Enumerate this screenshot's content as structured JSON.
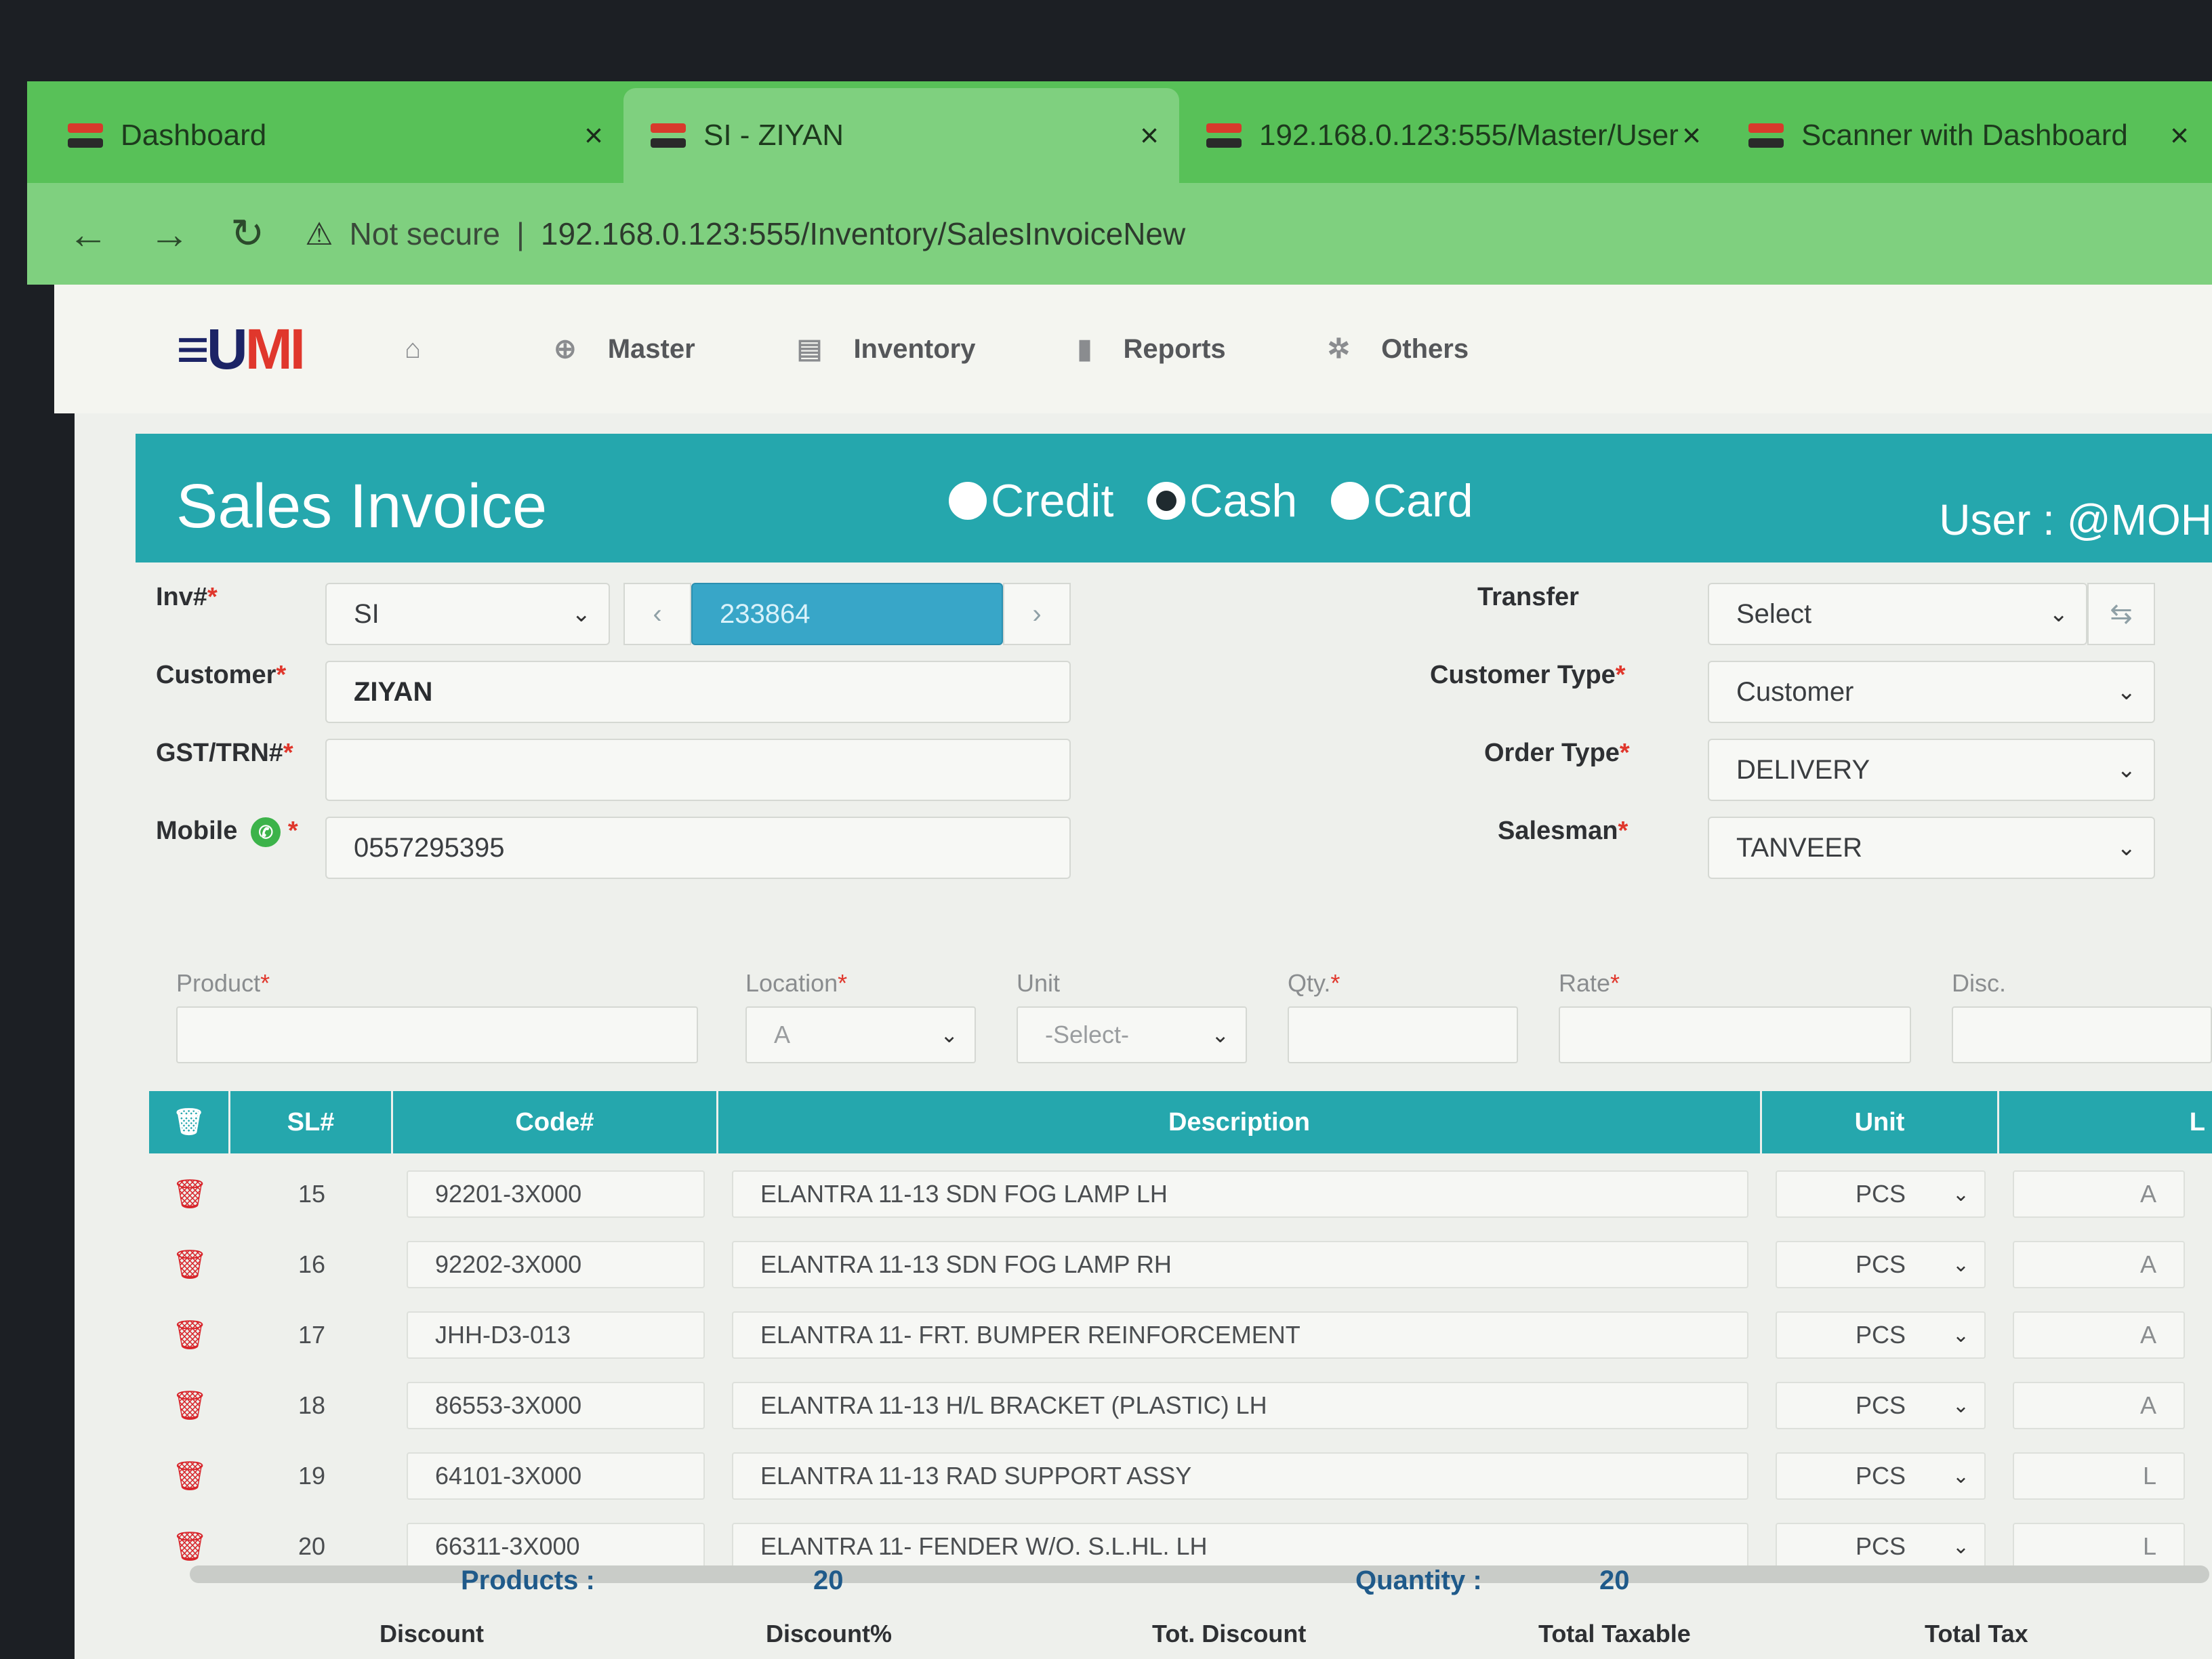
{
  "browser": {
    "tabs": [
      {
        "label": "Dashboard",
        "close": "×"
      },
      {
        "label": "SI - ZIYAN",
        "close": "×"
      },
      {
        "label": "192.168.0.123:555/Master/User",
        "close": "×"
      },
      {
        "label": "Scanner with Dashboard",
        "close": "×"
      }
    ],
    "security_label": "Not secure",
    "url": "192.168.0.123:555/Inventory/SalesInvoiceNew"
  },
  "app": {
    "logo_main": "≡U",
    "logo_accent": "MI",
    "menu": [
      "Master",
      "Inventory",
      "Reports",
      "Others"
    ]
  },
  "title": "Sales Invoice",
  "payment": {
    "options": [
      "Credit",
      "Cash",
      "Card"
    ],
    "selected": "Cash"
  },
  "user_label": "User : @MOH",
  "form": {
    "inv_label": "Inv#",
    "inv_prefix": "SI",
    "inv_number": "233864",
    "customer_label": "Customer",
    "customer": "ZIYAN",
    "gst_label": "GST/TRN#",
    "gst": "",
    "mobile_label": "Mobile",
    "mobile": "0557295395",
    "transfer_label": "Transfer",
    "transfer": "Select",
    "customer_type_label": "Customer Type",
    "customer_type": "Customer",
    "order_type_label": "Order Type",
    "order_type": "DELIVERY",
    "salesman_label": "Salesman",
    "salesman": "TANVEER",
    "req": "*"
  },
  "entry": {
    "product_label": "Product",
    "location_label": "Location",
    "location": "A",
    "unit_label": "Unit",
    "unit_placeholder": "-Select-",
    "qty_label": "Qty.",
    "rate_label": "Rate",
    "disc_label": "Disc."
  },
  "grid": {
    "headers": [
      "SL#",
      "Code#",
      "Description",
      "Unit",
      "L"
    ],
    "rows": [
      {
        "sl": "15",
        "code": "92201-3X000",
        "desc": "ELANTRA 11-13 SDN FOG LAMP LH",
        "unit": "PCS",
        "loc": "A"
      },
      {
        "sl": "16",
        "code": "92202-3X000",
        "desc": "ELANTRA 11-13 SDN FOG LAMP RH",
        "unit": "PCS",
        "loc": "A"
      },
      {
        "sl": "17",
        "code": "JHH-D3-013",
        "desc": "ELANTRA 11- FRT. BUMPER REINFORCEMENT",
        "unit": "PCS",
        "loc": "A"
      },
      {
        "sl": "18",
        "code": "86553-3X000",
        "desc": "ELANTRA 11-13 H/L BRACKET (PLASTIC) LH",
        "unit": "PCS",
        "loc": "A"
      },
      {
        "sl": "19",
        "code": "64101-3X000",
        "desc": "ELANTRA 11-13 RAD SUPPORT ASSY",
        "unit": "PCS",
        "loc": "L"
      },
      {
        "sl": "20",
        "code": "66311-3X000",
        "desc": "ELANTRA 11- FENDER W/O. S.L.HL. LH",
        "unit": "PCS",
        "loc": "L"
      }
    ]
  },
  "totals": {
    "products_label": "Products :",
    "products": "20",
    "quantity_label": "Quantity :",
    "quantity": "20",
    "footer": [
      "Discount",
      "Discount%",
      "Tot. Discount",
      "Total Taxable",
      "Total Tax"
    ]
  },
  "colors": {
    "accent": "#25a7ad",
    "tab_green": "#58c158",
    "delete_red": "#d8262c"
  },
  "icons": {
    "home": "home-icon",
    "master": "globe-icon",
    "inventory": "box-icon",
    "reports": "bar-chart-icon",
    "others": "gear-icon",
    "whatsapp": "whatsapp-icon",
    "delete": "trash-icon"
  }
}
